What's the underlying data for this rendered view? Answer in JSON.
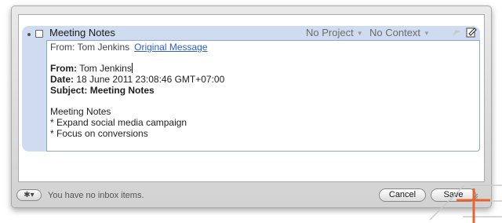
{
  "task": {
    "title": "Meeting Notes",
    "project": "No Project",
    "context": "No Context",
    "flag_icon": "flag-icon",
    "note_icon": "note-icon"
  },
  "note": {
    "from_line_label": "From: Tom Jenkins",
    "original_link": "Original Message",
    "from_label": "From:",
    "from_value": "Tom Jenkins",
    "date_label": "Date:",
    "date_value": "18 June 2011 23:08:46 GMT+07:00",
    "subject_label": "Subject:",
    "subject_value": "Meeting Notes",
    "body_title": "Meeting Notes",
    "bullets": [
      "* Expand social media campaign",
      "* Focus on conversions"
    ]
  },
  "statusbar": {
    "gear_icon": "gear-icon",
    "message": "You have no inbox items.",
    "cancel_label": "Cancel",
    "save_label": "Save"
  },
  "colors": {
    "row_bg": "#cfdbee",
    "link": "#2a5fc9",
    "overlay_orange": "#e8632d"
  }
}
